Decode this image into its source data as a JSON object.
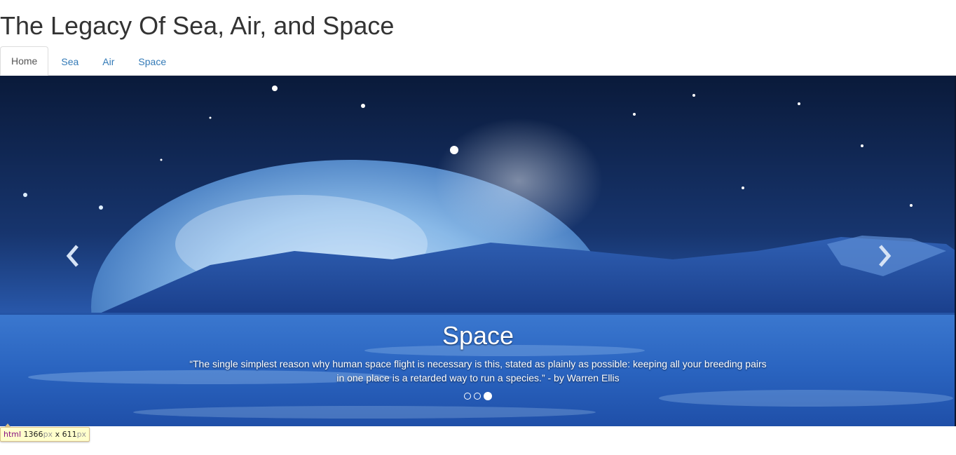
{
  "header": {
    "title": "The Legacy Of Sea, Air, and Space"
  },
  "nav": {
    "tabs": [
      {
        "label": "Home",
        "active": true
      },
      {
        "label": "Sea",
        "active": false
      },
      {
        "label": "Air",
        "active": false
      },
      {
        "label": "Space",
        "active": false
      }
    ]
  },
  "carousel": {
    "slide": {
      "title": "Space",
      "text": "“The single simplest reason why human space flight is necessary is this, stated as plainly as possible: keeping all your breeding pairs in one place is a retarded way to run a species.” - by Warren Ellis"
    },
    "indicator_count": 3,
    "active_indicator": 3,
    "prev_icon": "chevron-left-icon",
    "next_icon": "chevron-right-icon"
  },
  "devtools_tooltip": {
    "tag": "html",
    "width_value": "1366",
    "height_value": "611",
    "unit": "px",
    "separator": "x"
  },
  "colors": {
    "link": "#337ab7",
    "title_text": "#333333",
    "tab_active_text": "#555555",
    "tab_border": "#dddddd",
    "tooltip_bg": "#ffffcc"
  }
}
